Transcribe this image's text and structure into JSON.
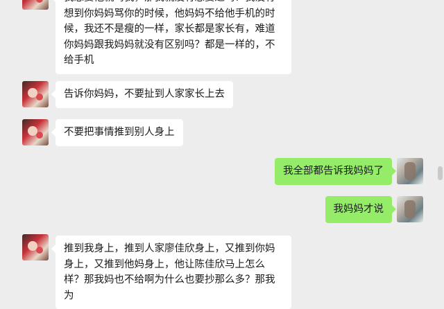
{
  "messages": [
    {
      "side": "left",
      "text": "我想要他就骂我，那我就没有想要过吗？我没有想到你妈妈骂你的时候，他妈妈不给他手机的时候，我还不是瘦的一样，家长都是家长有，难道你妈妈跟我妈妈就没有区别吗？都是一样的，不给手机"
    },
    {
      "side": "left",
      "text": "告诉你妈妈，不要扯到人家家长上去"
    },
    {
      "side": "left",
      "text": "不要把事情推到别人身上"
    },
    {
      "side": "right",
      "text": "我全部都告诉我妈妈了"
    },
    {
      "side": "right",
      "text": "我妈妈才说"
    },
    {
      "side": "left",
      "text": "推到我身上，推到人家廖佳欣身上，又推到你妈身上，又推到他妈身上，他让陈佳欣马上怎么样？那我妈也不给啊为什么也要抄那么多？那我为"
    }
  ],
  "colors": {
    "background": "#ededed",
    "bubble_left": "#ffffff",
    "bubble_right": "#95ec69"
  }
}
